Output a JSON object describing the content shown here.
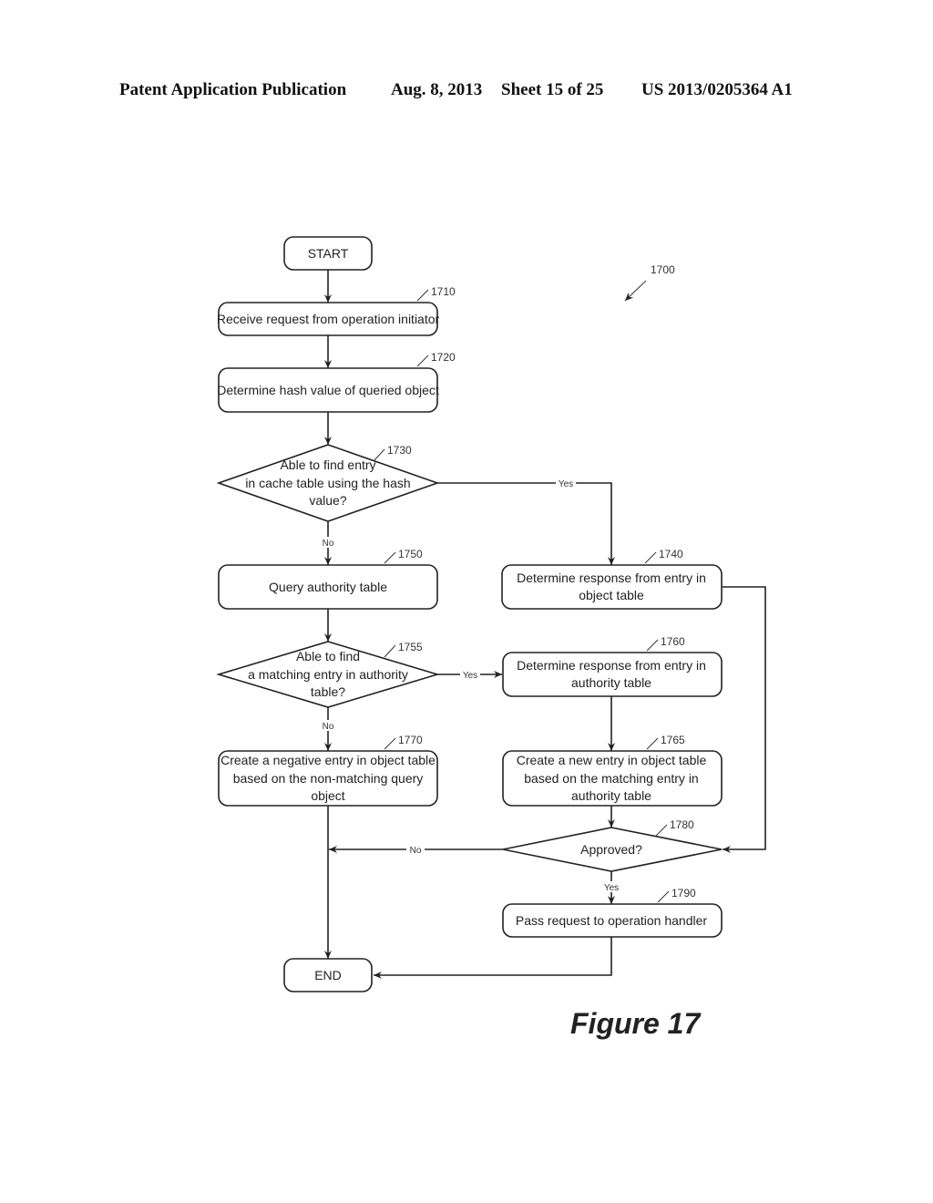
{
  "header": {
    "publication": "Patent Application Publication",
    "date": "Aug. 8, 2013",
    "sheet": "Sheet 15 of 25",
    "number": "US 2013/0205364 A1"
  },
  "figure": {
    "ref": "1700",
    "caption": "Figure 17"
  },
  "nodes": {
    "start": {
      "label": "START"
    },
    "n1710": {
      "ref": "1710",
      "lines": [
        "Receive request from operation initiator"
      ]
    },
    "n1720": {
      "ref": "1720",
      "lines": [
        "Determine hash value of queried object"
      ]
    },
    "n1730": {
      "ref": "1730",
      "lines": [
        "Able to find entry",
        "in cache table using the hash",
        "value?"
      ]
    },
    "n1740": {
      "ref": "1740",
      "lines": [
        "Determine response from entry in",
        "object table"
      ]
    },
    "n1750": {
      "ref": "1750",
      "lines": [
        "Query authority table"
      ]
    },
    "n1755": {
      "ref": "1755",
      "lines": [
        "Able to find",
        "a matching entry in authority",
        "table?"
      ]
    },
    "n1760": {
      "ref": "1760",
      "lines": [
        "Determine response from entry in",
        "authority table"
      ]
    },
    "n1765": {
      "ref": "1765",
      "lines": [
        "Create a new entry in object table",
        "based on the matching entry in",
        "authority table"
      ]
    },
    "n1770": {
      "ref": "1770",
      "lines": [
        "Create a negative entry in object table",
        "based on the non-matching query",
        "object"
      ]
    },
    "n1780": {
      "ref": "1780",
      "lines": [
        "Approved?"
      ]
    },
    "n1790": {
      "ref": "1790",
      "lines": [
        "Pass request to operation handler"
      ]
    },
    "end": {
      "label": "END"
    }
  },
  "edge_labels": {
    "e1730_yes": "Yes",
    "e1730_no": "No",
    "e1755_yes": "Yes",
    "e1755_no": "No",
    "e1780_no": "No",
    "e1780_yes": "Yes"
  }
}
